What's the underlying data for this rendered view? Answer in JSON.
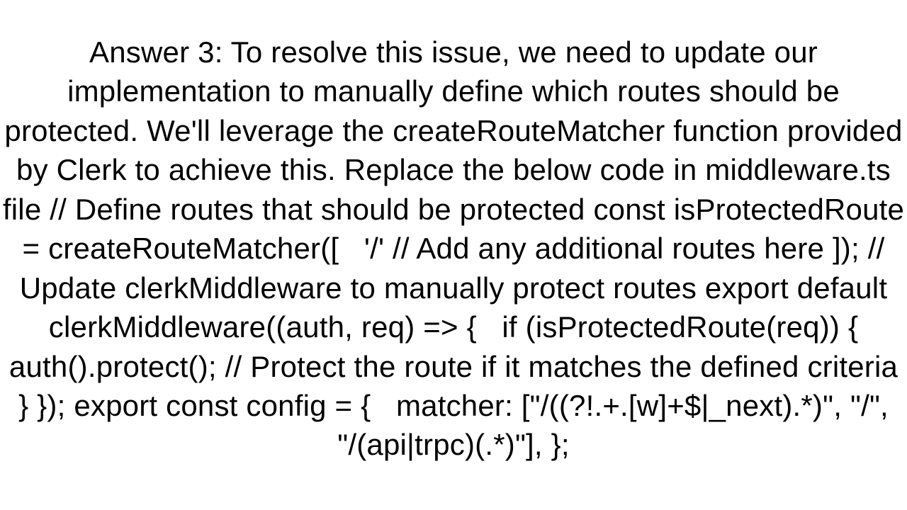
{
  "answer": {
    "text": "Answer 3: To resolve this issue, we need to update our implementation to manually define which routes should be protected. We'll leverage the createRouteMatcher function provided by Clerk to achieve this. Replace the below code in middleware.ts file // Define routes that should be protected const isProtectedRoute = createRouteMatcher([   '/' // Add any additional routes here ]); // Update clerkMiddleware to manually protect routes export default clerkMiddleware((auth, req) => {   if (isProtectedRoute(req)) {     auth().protect(); // Protect the route if it matches the defined criteria   } }); export const config = {   matcher: [\"/((?!.+.[w]+$|_next).*)\", \"/\", \"/(api|trpc)(.*)\"], };"
  }
}
